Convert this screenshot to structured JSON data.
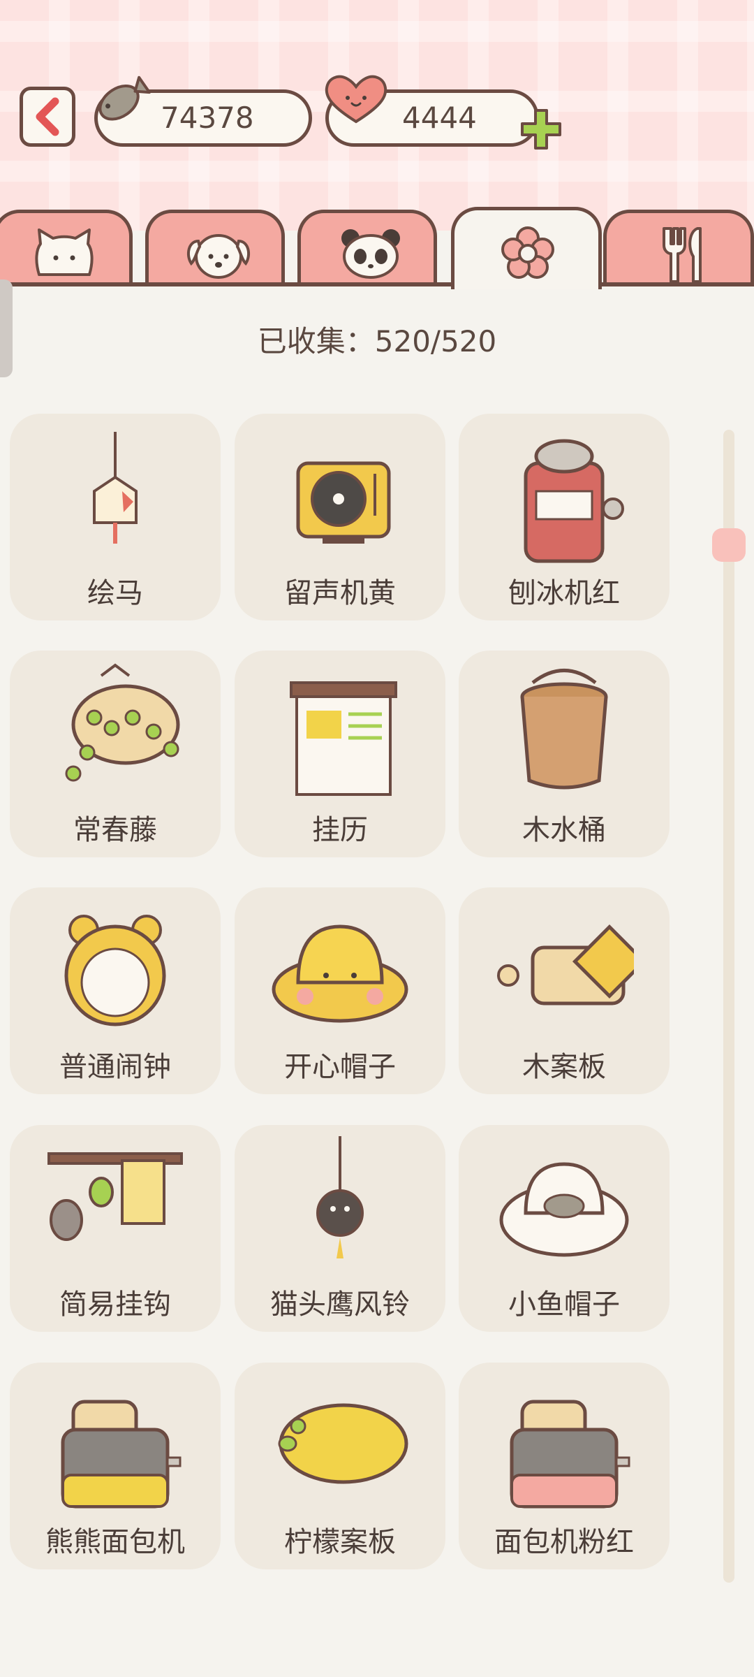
{
  "header": {
    "fish_count": "74378",
    "heart_count": "4444"
  },
  "tabs": [
    {
      "name": "cat"
    },
    {
      "name": "dog"
    },
    {
      "name": "panda"
    },
    {
      "name": "flower",
      "active": true
    },
    {
      "name": "cutlery"
    }
  ],
  "collection": {
    "label": "已收集：520/520"
  },
  "items": [
    {
      "label": "绘马",
      "icon": "ema-icon"
    },
    {
      "label": "留声机黄",
      "icon": "record-player-icon"
    },
    {
      "label": "刨冰机红",
      "icon": "shaved-ice-machine-icon"
    },
    {
      "label": "常春藤",
      "icon": "ivy-icon"
    },
    {
      "label": "挂历",
      "icon": "wall-calendar-icon"
    },
    {
      "label": "木水桶",
      "icon": "wooden-bucket-icon"
    },
    {
      "label": "普通闹钟",
      "icon": "alarm-clock-icon"
    },
    {
      "label": "开心帽子",
      "icon": "happy-hat-icon"
    },
    {
      "label": "木案板",
      "icon": "cutting-board-icon"
    },
    {
      "label": "简易挂钩",
      "icon": "hook-rack-icon"
    },
    {
      "label": "猫头鹰风铃",
      "icon": "owl-wind-chime-icon"
    },
    {
      "label": "小鱼帽子",
      "icon": "fish-hat-icon"
    },
    {
      "label": "熊熊面包机",
      "icon": "bear-toaster-icon"
    },
    {
      "label": "柠檬案板",
      "icon": "lemon-board-icon"
    },
    {
      "label": "面包机粉红",
      "icon": "pink-toaster-icon"
    }
  ],
  "colors": {
    "accent": "#f4a9a1",
    "outline": "#6b4b42",
    "card": "#efe9df",
    "background": "#f5f3ee",
    "plus_green": "#a7d152"
  }
}
